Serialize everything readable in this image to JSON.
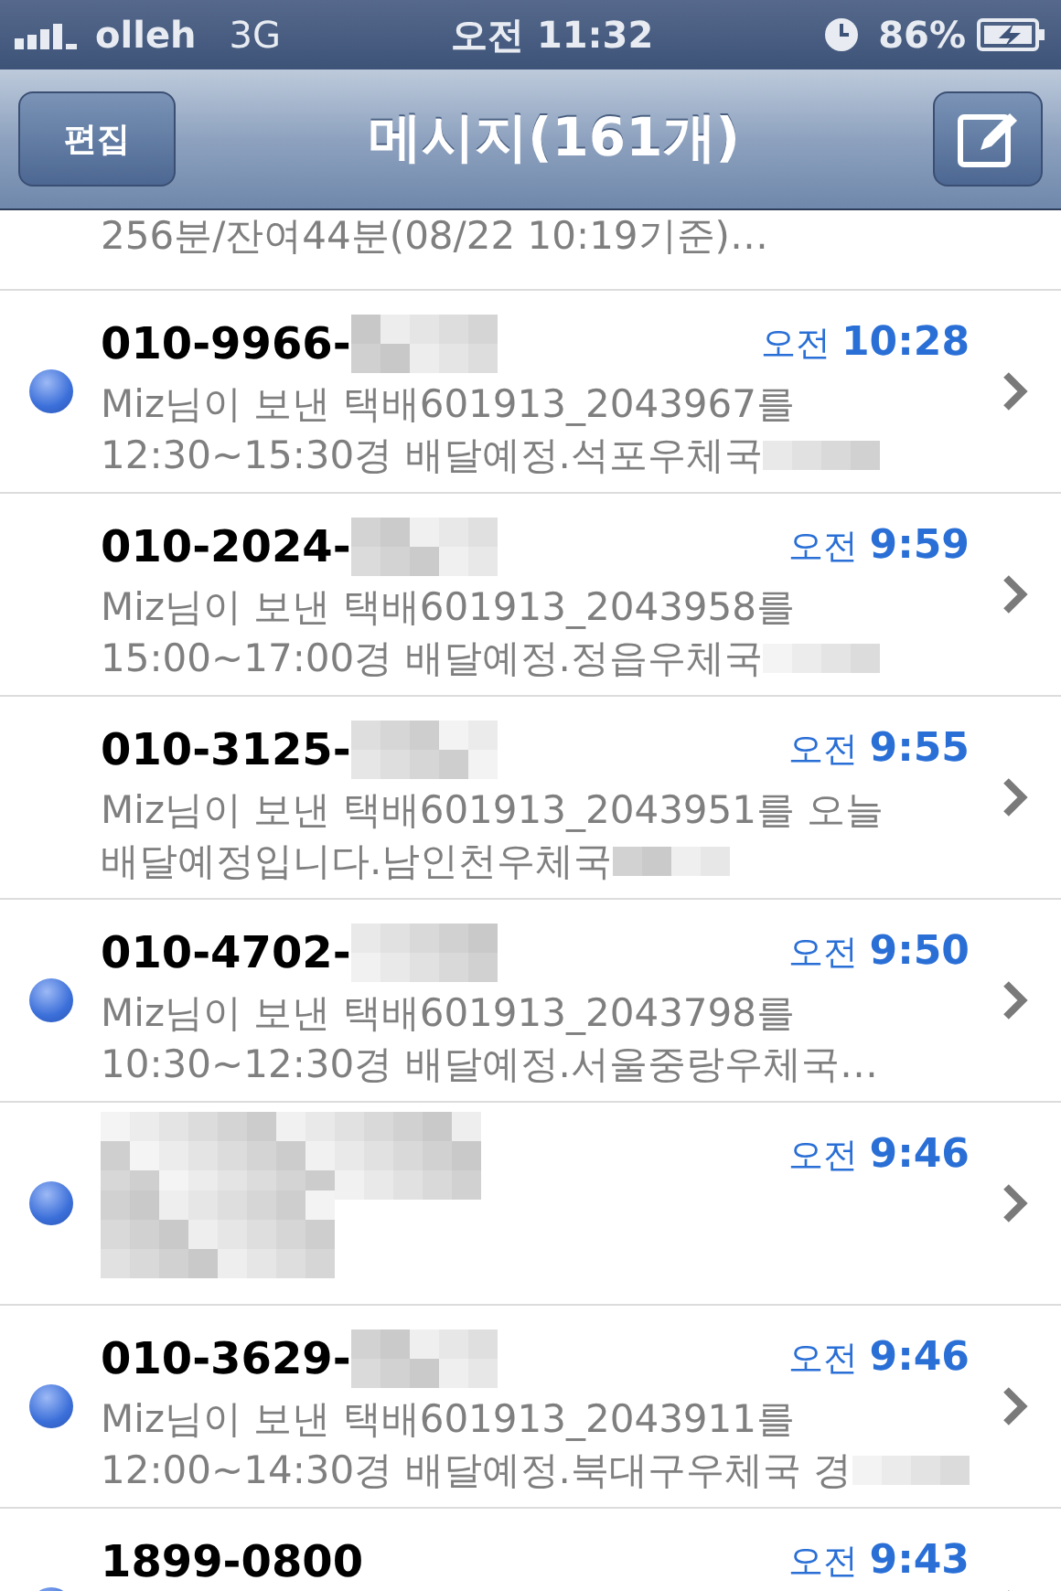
{
  "status_bar": {
    "carrier": "olleh",
    "network": "3G",
    "time": "오전 11:32",
    "battery": "86%"
  },
  "nav_bar": {
    "edit_button": "편집",
    "title": "메시지(161개)"
  },
  "partial_message": {
    "preview": "256분/잔여44분(08/22 10:19기준)…"
  },
  "messages": [
    {
      "sender": "010-9966-",
      "sender_blurred": true,
      "time_period": "오전",
      "time": "10:28",
      "unread": true,
      "preview": [
        "Miz님이 보낸 택배601913_2043967를",
        "12:30~15:30경 배달예정.석포우체국"
      ],
      "preview_blurred": true
    },
    {
      "sender": "010-2024-",
      "sender_blurred": true,
      "time_period": "오전",
      "time": "9:59",
      "unread": false,
      "preview": [
        "Miz님이 보낸 택배601913_2043958를",
        "15:00~17:00경 배달예정.정읍우체국"
      ],
      "preview_blurred": true
    },
    {
      "sender": "010-3125-",
      "sender_blurred": true,
      "time_period": "오전",
      "time": "9:55",
      "unread": false,
      "preview": [
        "Miz님이 보낸 택배601913_2043951를 오늘",
        "배달예정입니다.남인천우체국"
      ],
      "preview_blurred": true
    },
    {
      "sender": "010-4702-",
      "sender_blurred": true,
      "time_period": "오전",
      "time": "9:50",
      "unread": true,
      "preview": [
        "Miz님이 보낸 택배601913_2043798를",
        "10:30~12:30경 배달예정.서울중랑우체국…"
      ],
      "preview_blurred": false
    },
    {
      "sender_blurred": true,
      "time_period": "오전",
      "time": "9:46",
      "unread": true,
      "preview_blurred": true
    },
    {
      "sender": "010-3629-",
      "sender_blurred": true,
      "time_period": "오전",
      "time": "9:46",
      "unread": true,
      "preview": [
        "Miz님이 보낸 택배601913_2043911를",
        "12:00~14:30경 배달예정.북대구우체국 경"
      ],
      "preview_blurred": true
    },
    {
      "sender": "1899-0800",
      "sender_blurred": false,
      "time_period": "오전",
      "time": "9:43",
      "unread": true,
      "preview_blurred": false
    }
  ]
}
